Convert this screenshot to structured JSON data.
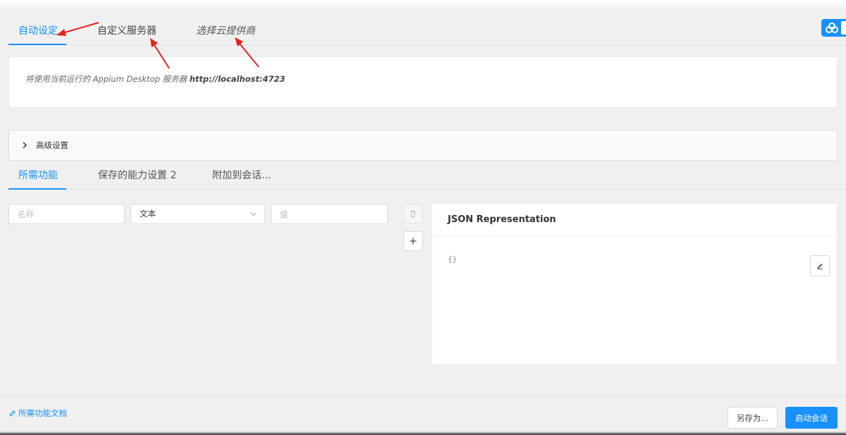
{
  "server_tabs": [
    {
      "label": "自动设定",
      "active": true
    },
    {
      "label": "自定义服务器",
      "active": false
    },
    {
      "label": "选择云提供商",
      "active": false
    }
  ],
  "server_info": {
    "prefix": "将使用当前运行的 Appium Desktop 服务器",
    "url": "http://localhost:4723"
  },
  "advanced": {
    "label": "高级设置"
  },
  "capability_tabs": [
    {
      "label": "所需功能",
      "active": true
    },
    {
      "label": "保存的能力设置 2",
      "active": false
    },
    {
      "label": "附加到会话...",
      "active": false
    }
  ],
  "capability_form": {
    "name_placeholder": "名称",
    "type_value": "文本",
    "value_placeholder": "值"
  },
  "json_panel": {
    "title": "JSON Representation",
    "content": "{}"
  },
  "footer": {
    "docs_link": "所需功能文档",
    "save_as_button": "另存为...",
    "start_session_button": "启动会话"
  },
  "colors": {
    "accent": "#1890ff",
    "annotation_arrow": "#e8211a",
    "background": "#f0f0f0"
  },
  "icons": [
    "cloud-icon",
    "chevron-right-icon",
    "chevron-down-icon",
    "trash-icon",
    "plus-icon",
    "edit-icon",
    "link-icon"
  ]
}
